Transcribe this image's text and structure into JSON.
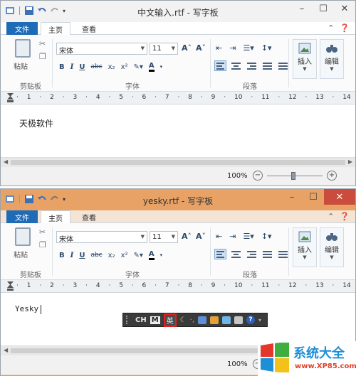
{
  "window1": {
    "title": "中文输入.rtf - 写字板",
    "tabs": {
      "file": "文件",
      "home": "主页",
      "view": "查看"
    },
    "clipboard": {
      "paste": "粘贴",
      "group": "剪贴板"
    },
    "font": {
      "name": "宋体",
      "size": "11",
      "group": "字体"
    },
    "paragraph": {
      "group": "段落"
    },
    "insert": "插入",
    "edit": "编辑",
    "ruler_numbers": [
      "1",
      "2",
      "3",
      "4",
      "5",
      "6",
      "7",
      "8",
      "9",
      "10",
      "11",
      "12",
      "13",
      "14"
    ],
    "doc_text": "天极软件",
    "zoom": "100%"
  },
  "window2": {
    "title": "yesky.rtf - 写字板",
    "tabs": {
      "file": "文件",
      "home": "主页",
      "view": "查看"
    },
    "clipboard": {
      "paste": "粘贴",
      "group": "剪贴板"
    },
    "font": {
      "name": "宋体",
      "size": "11",
      "group": "字体"
    },
    "paragraph": {
      "group": "段落"
    },
    "insert": "插入",
    "edit": "编辑",
    "ruler_numbers": [
      "1",
      "2",
      "3",
      "4",
      "5",
      "6",
      "7",
      "8",
      "9",
      "10",
      "11",
      "12",
      "13",
      "14"
    ],
    "doc_text": "Yesky",
    "zoom": "100%"
  },
  "ime": {
    "mode": "CH",
    "m": "M",
    "lang": "英"
  },
  "watermark": {
    "name": "系统大全",
    "url": "www.XP85.com"
  },
  "colors": {
    "file_tab": "#1e6bb8",
    "title2_bg": "#e8a266",
    "close_red": "#c94c3c",
    "ime_highlight": "#e02020"
  }
}
